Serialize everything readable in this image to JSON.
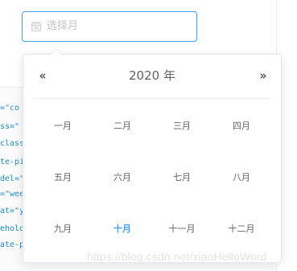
{
  "input": {
    "placeholder": "选择月",
    "icon": "calendar-icon"
  },
  "picker": {
    "prev_year_icon": "«",
    "next_year_icon": "»",
    "header_label": "2020 年",
    "months": [
      "一月",
      "二月",
      "三月",
      "四月",
      "五月",
      "六月",
      "七月",
      "八月",
      "九月",
      "十月",
      "十一月",
      "十二月"
    ],
    "current_month_index": 9,
    "accent_color": "#409eff"
  },
  "background_code": [
    {
      "attr": "=\"co",
      "eq": ""
    },
    {
      "attr": "ss=\"",
      "eq": ""
    },
    {
      "attr": "class",
      "eq": ""
    },
    {
      "attr": "te-pi",
      "eq": ""
    },
    {
      "attr": "del=\"",
      "eq": ""
    },
    {
      "attr": "=\"wee",
      "eq": ""
    },
    {
      "attr": "at=\"y",
      "eq": ""
    },
    {
      "attr": "ehold",
      "eq": ""
    },
    {
      "attr": "ate-p",
      "eq": ""
    }
  ],
  "watermark": "https://blog.csdn.net/xiaoHelloWord"
}
